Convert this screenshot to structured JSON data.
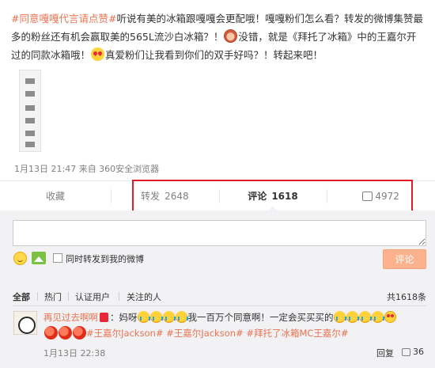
{
  "post": {
    "topic_tag": "#同意嘎嘎代言请点赞#",
    "text_part1": "听说有美的冰箱跟嘎嘎会更配哦！嘎嘎粉们怎么看？转发的微博集赞最多的粉丝还有机会赢取美的565L流沙白冰箱？！",
    "text_part2": "没错，就是《拜托了冰箱》中的王嘉尔开过的同款冰箱哦！",
    "text_part3": "真爱粉们让我看到你们的双手好吗？！转起来吧！",
    "meta": "1月13日 21:47 来自 360安全浏览器",
    "emoji1": "monkey-face-icon",
    "emoji2": "heart-eyes-icon"
  },
  "actions": {
    "favorite_label": "收藏",
    "repost_label": "转发",
    "repost_count": "2648",
    "comment_label": "评论",
    "comment_count": "1618",
    "like_count": "4972",
    "highlight_color": "#e21b25"
  },
  "composer": {
    "input_value": "",
    "forward_label": "同时转发到我的微博",
    "submit_label": "评论",
    "submit_color": "#fbb28d"
  },
  "filters": {
    "all": "全部",
    "hot": "热门",
    "verified": "认证用户",
    "following": "关注的人",
    "total": "共1618条"
  },
  "comment": {
    "username": "再见过去啊啊",
    "prefix": "：妈呀",
    "middle": "我一百万个同意啊！一定会买买买的",
    "tags": "#王嘉尔Jackson# #王嘉尔Jackson# #拜托了冰箱MC王嘉尔#",
    "time": "1月13日 22:38",
    "reply_label": "回复",
    "like_count": "36"
  },
  "colors": {
    "accent": "#eb7350",
    "panel_bg": "#f2f2f5"
  }
}
